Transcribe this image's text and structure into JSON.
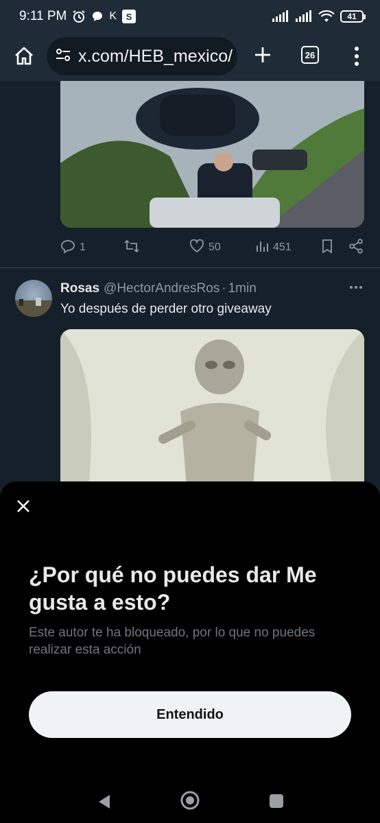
{
  "status_bar": {
    "time": "9:11 PM",
    "k_label": "K",
    "s_label": "S",
    "battery": "41"
  },
  "browser": {
    "url": "x.com/HEB_mexico/",
    "tab_count": "26"
  },
  "previous_tweet": {
    "replies": "1",
    "likes": "50",
    "views": "451"
  },
  "tweet": {
    "name": "Rosas",
    "handle": "@HectorAndresRos",
    "separator": "·",
    "time": "1min",
    "text": "Yo después de perder otro giveaway"
  },
  "sheet": {
    "title": "¿Por qué no puedes dar Me gusta a esto?",
    "body": "Este autor te ha bloqueado, por lo que no puedes realizar esta acción",
    "button_label": "Entendido"
  },
  "icons": {
    "home": "home-icon",
    "site_settings": "site-settings-icon",
    "new_tab": "plus-icon",
    "menu": "more-vert-icon",
    "reply": "reply-icon",
    "retweet": "retweet-icon",
    "like": "heart-icon",
    "views": "views-icon",
    "bookmark": "bookmark-icon",
    "share": "share-icon",
    "close": "close-icon"
  },
  "colors": {
    "background": "#15202b",
    "sheet": "#000000",
    "button": "#eff3f4",
    "muted_text": "#8b98a5"
  }
}
